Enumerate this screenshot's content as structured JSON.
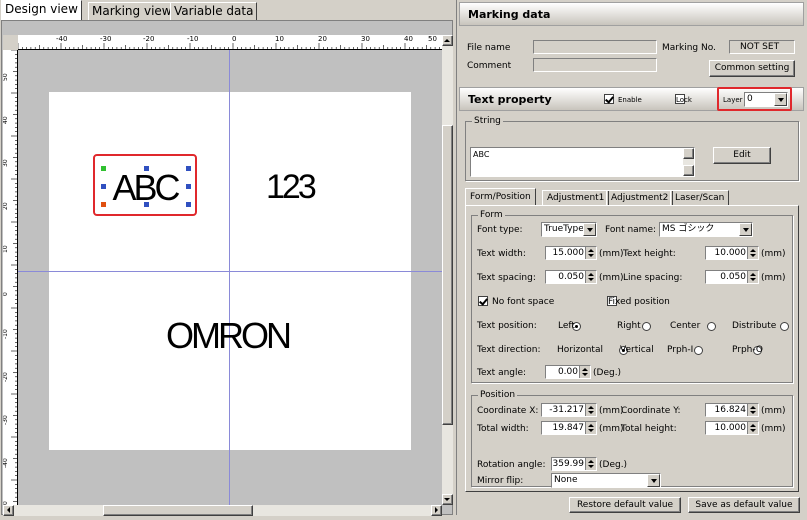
{
  "design_tabs": [
    "Design view",
    "Marking view",
    "Variable data"
  ],
  "ruler": {
    "top": [
      "-40",
      "-30",
      "-20",
      "-10",
      "0",
      "10",
      "20",
      "30",
      "40",
      "50"
    ],
    "left": [
      "50",
      "40",
      "30",
      "20",
      "10",
      "0",
      "-10",
      "-20",
      "-30",
      "-40",
      "-50"
    ]
  },
  "canvas": {
    "text1": "ABC",
    "text2": "123",
    "text3": "OMRON"
  },
  "marking_data": {
    "title": "Marking data",
    "file_name_label": "File name",
    "file_name_value": "",
    "marking_no_label": "Marking No.",
    "marking_no_value": "NOT SET",
    "comment_label": "Comment",
    "comment_value": "",
    "common_setting": "Common setting"
  },
  "text_property": {
    "title": "Text property",
    "enable_label": "Enable",
    "enable_checked": true,
    "lock_label": "Lock",
    "lock_checked": false,
    "layer_label": "Layer",
    "layer_value": "0"
  },
  "string": {
    "group": "String",
    "value": "ABC",
    "edit_button": "Edit"
  },
  "tabs": [
    "Form/Position",
    "Adjustment1",
    "Adjustment2",
    "Laser/Scan"
  ],
  "form": {
    "group": "Form",
    "font_type_label": "Font type:",
    "font_type_value": "TrueType",
    "font_name_label": "Font name:",
    "font_name_value": "MS ゴシック",
    "text_width_label": "Text width:",
    "text_width_value": "15.000",
    "unit_mm": "(mm)",
    "text_height_label": "Text height:",
    "text_height_value": "10.000",
    "text_spacing_label": "Text spacing:",
    "text_spacing_value": "0.050",
    "line_spacing_label": "Line spacing:",
    "line_spacing_value": "0.050",
    "no_font_space_label": "No font space",
    "no_font_space_checked": true,
    "fixed_position_label": "Fixed position",
    "fixed_position_checked": false,
    "text_position_label": "Text position:",
    "text_position_options": [
      "Left",
      "Right",
      "Center",
      "Distribute"
    ],
    "text_position_selected": "Left",
    "text_direction_label": "Text direction:",
    "text_direction_options": [
      "Horizontal",
      "Vertical",
      "Prph-I",
      "Prph-O"
    ],
    "text_direction_selected": "Horizontal",
    "text_angle_label": "Text angle:",
    "text_angle_value": "0.00",
    "unit_deg": "(Deg.)"
  },
  "position": {
    "group": "Position",
    "coord_x_label": "Coordinate X:",
    "coord_x_value": "-31.217",
    "coord_y_label": "Coordinate Y:",
    "coord_y_value": "16.824",
    "total_width_label": "Total width:",
    "total_width_value": "19.847",
    "total_height_label": "Total height:",
    "total_height_value": "10.000",
    "rotation_label": "Rotation angle:",
    "rotation_value": "359.99",
    "mirror_label": "Mirror flip:",
    "mirror_value": "None"
  },
  "buttons": {
    "restore": "Restore default value",
    "save_default": "Save as default value"
  }
}
